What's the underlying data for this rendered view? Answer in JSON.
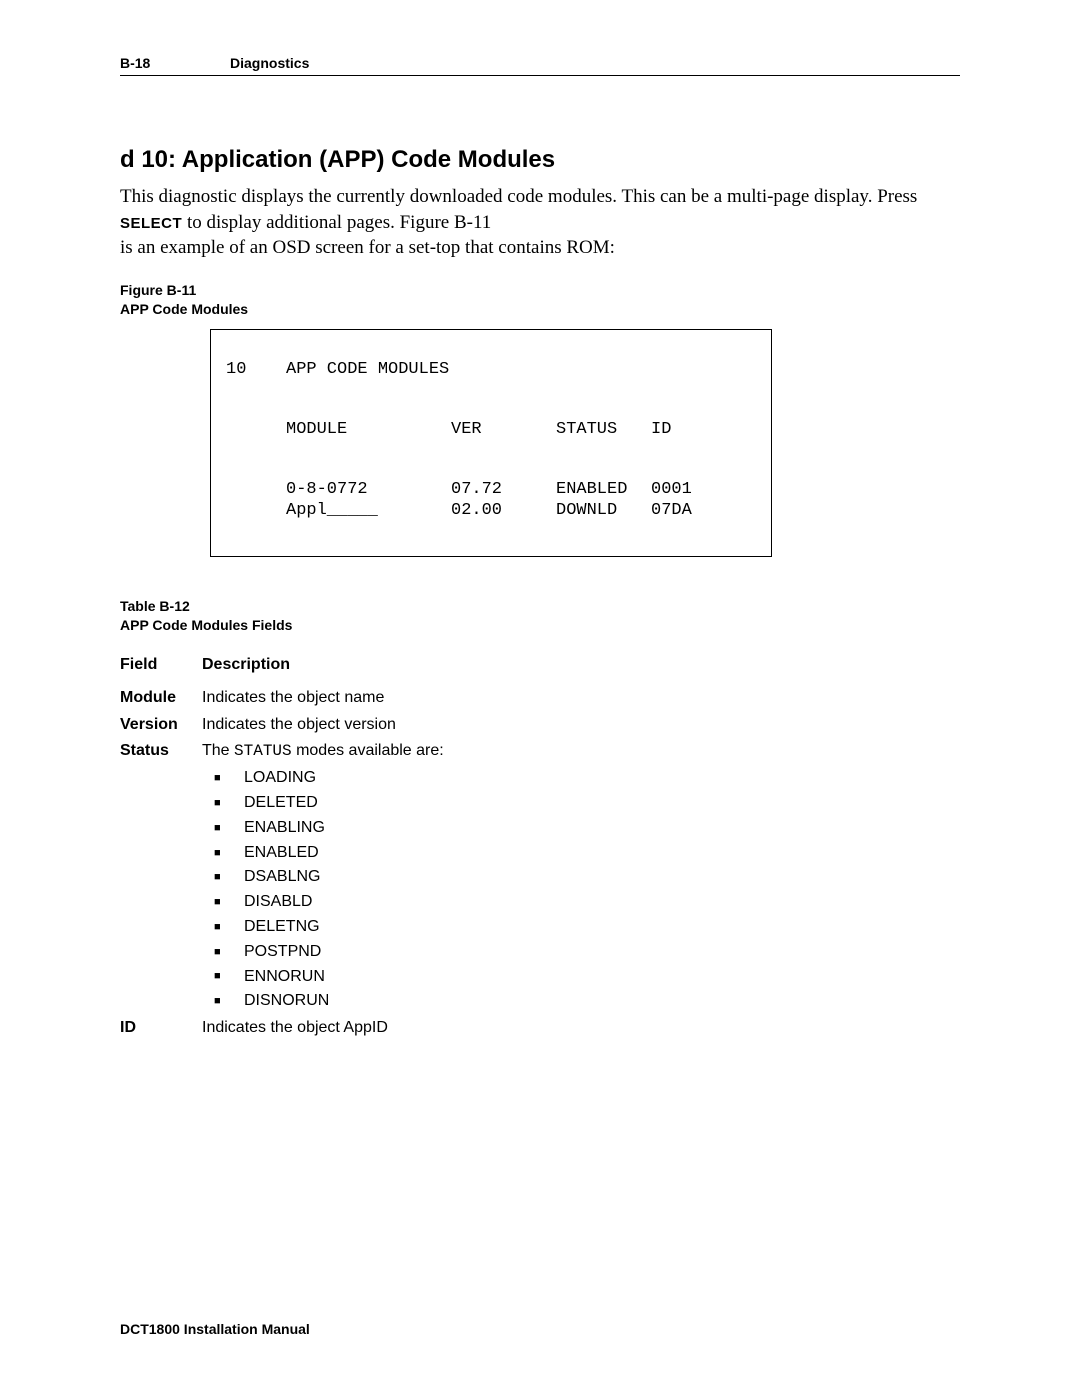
{
  "header": {
    "page_num": "B-18",
    "section": "Diagnostics"
  },
  "title": "d 10: Application (APP) Code Modules",
  "intro": {
    "line1a": "This diagnostic displays the currently downloaded code modules. This can be a multi-page display. Press ",
    "select_word": "SELECT",
    "line1b": " to display additional pages. Figure B-11",
    "line2": " is an example of an OSD screen for a set-top that contains ROM:"
  },
  "figure": {
    "num": "Figure B-11",
    "title": "APP Code Modules"
  },
  "osd": {
    "num": "10",
    "heading": "APP CODE MODULES",
    "cols": {
      "module": "MODULE",
      "ver": "VER",
      "status": "STATUS",
      "id": "ID"
    },
    "rows": [
      {
        "module": "0-8-0772",
        "ver": "07.72",
        "status": "ENABLED",
        "id": "0001"
      },
      {
        "module": "Appl_____",
        "ver": "02.00",
        "status": "DOWNLD",
        "id": "07DA"
      }
    ]
  },
  "table": {
    "num": "Table B-12",
    "title": "APP Code Modules Fields",
    "header": {
      "field": "Field",
      "desc": "Description"
    },
    "rows": {
      "module": {
        "field": "Module",
        "desc": "Indicates the object name"
      },
      "version": {
        "field": "Version",
        "desc": "Indicates the object version"
      },
      "status": {
        "field": "Status",
        "desc_prefix": "The ",
        "desc_code": "STATUS",
        "desc_suffix": " modes available are:",
        "items": [
          "LOADING",
          "DELETED",
          "ENABLING",
          "ENABLED",
          "DSABLNG",
          "DISABLD",
          "DELETNG",
          "POSTPND",
          "ENNORUN",
          "DISNORUN"
        ]
      },
      "id": {
        "field": "ID",
        "desc": "Indicates the object AppID"
      }
    }
  },
  "footer": "DCT1800 Installation Manual"
}
